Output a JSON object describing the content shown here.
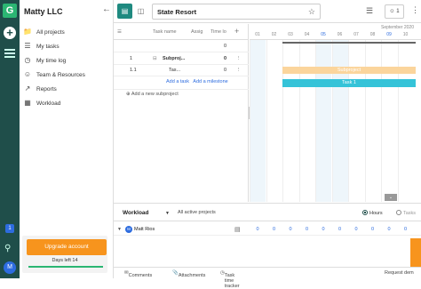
{
  "rail": {
    "logo": "G",
    "plus": "+",
    "notification_count": "1",
    "avatar": "M"
  },
  "sidebar": {
    "company": "Matty LLC",
    "items": [
      {
        "label": "All projects",
        "icon": "folder-icon"
      },
      {
        "label": "My tasks",
        "icon": "tasks-icon"
      },
      {
        "label": "My time log",
        "icon": "clock-icon"
      },
      {
        "label": "Team & Resources",
        "icon": "team-icon"
      },
      {
        "label": "Reports",
        "icon": "chart-icon"
      },
      {
        "label": "Workload",
        "icon": "grid-icon"
      }
    ],
    "upgrade_label": "Upgrade account",
    "days_left": "Days left 14"
  },
  "topbar": {
    "project_title": "State Resort",
    "people_count": "1"
  },
  "grid": {
    "headers": {
      "task_name": "Task name",
      "assigned": "Assig",
      "time": "Time lo"
    },
    "top_row_value": "0",
    "rows": [
      {
        "num": "1",
        "name": "Subproj...",
        "time": "0"
      },
      {
        "num": "1.1",
        "name": "Tas...",
        "time": "0"
      }
    ],
    "add_task": "Add a task",
    "add_milestone": "Add a milestone",
    "add_subproject": "Add a new subproject"
  },
  "gantt": {
    "month": "September 2020",
    "days": [
      "01",
      "02",
      "03",
      "04",
      "05",
      "06",
      "07",
      "08",
      "09",
      "10"
    ],
    "subproject_label": "Subproject",
    "task_label": "Task 1"
  },
  "workload": {
    "title": "Workload",
    "filter": "All active projects",
    "hours_label": "Hours",
    "tasks_label": "Tasks",
    "person": "Matt Rios",
    "values": [
      "0",
      "0",
      "0",
      "0",
      "0",
      "0",
      "0",
      "0",
      "0",
      "0"
    ]
  },
  "footer": {
    "comments": "Comments",
    "attachments": "Attachments",
    "tracker": "Task time tracker",
    "request": "Request dem"
  }
}
